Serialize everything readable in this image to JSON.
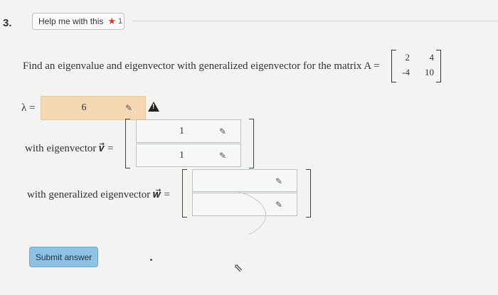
{
  "question_number": "3.",
  "help_button": {
    "label": "Help me with this",
    "count": "1"
  },
  "prompt": "Find an eigenvalue and eigenvector with generalized eigenvector for the matrix A =",
  "matrix": {
    "r1c1": "2",
    "r1c2": "4",
    "r2c1": "-4",
    "r2c2": "10"
  },
  "lambda": {
    "label": "λ =",
    "value": "6"
  },
  "eigenvector": {
    "label": "with eigenvector 𝒗⃗ =",
    "v1": "1",
    "v2": "1"
  },
  "generalized_eigenvector": {
    "label": "with generalized eigenvector 𝒘⃗ =",
    "w1": "",
    "w2": ""
  },
  "submit_button": {
    "label": "Submit answer"
  }
}
